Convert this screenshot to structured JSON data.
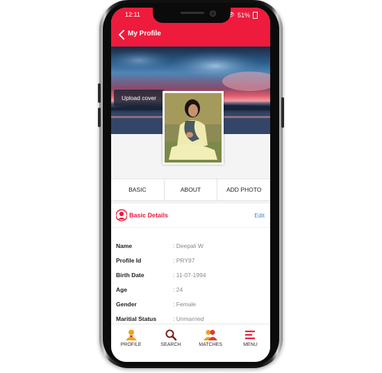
{
  "status": {
    "time": "12:11",
    "battery": "51%"
  },
  "header": {
    "title": "My Profile"
  },
  "cover": {
    "upload_label": "Upload cover"
  },
  "tabs": [
    "BASIC",
    "ABOUT",
    "ADD PHOTO"
  ],
  "details": {
    "title": "Basic Details",
    "edit_label": "Edit",
    "rows": [
      {
        "label": "Name",
        "value": ": Deepali W"
      },
      {
        "label": "Profile Id",
        "value": ": PRY97"
      },
      {
        "label": "Birth Date",
        "value": ": 11-07-1994"
      },
      {
        "label": "Age",
        "value": ": 24"
      },
      {
        "label": "Gender",
        "value": ": Female"
      },
      {
        "label": "Maritial Status",
        "value": ": Unmarried"
      }
    ]
  },
  "nav": [
    {
      "label": "PROFILE",
      "icon": "profile-icon"
    },
    {
      "label": "SEARCH",
      "icon": "search-icon"
    },
    {
      "label": "MATCHES",
      "icon": "matches-icon"
    },
    {
      "label": "MENU",
      "icon": "menu-icon"
    }
  ],
  "colors": {
    "accent": "#ee1b3d",
    "link": "#3a7fd6",
    "icon_orange": "#f4a020"
  }
}
